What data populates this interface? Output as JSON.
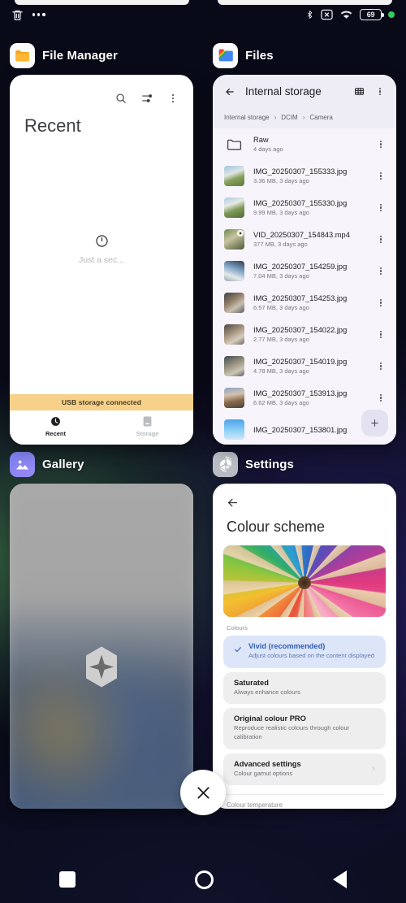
{
  "statusbar": {
    "trash_icon": "trash-icon",
    "more_icon": "more-options-icon",
    "bluetooth_icon": "bluetooth-icon",
    "sim_icon": "no-sim-icon",
    "wifi_icon": "wifi-6-icon",
    "wifi_label": "6",
    "battery_level": "69",
    "recording_dot": "green-status-dot"
  },
  "cards": {
    "file_manager": {
      "app_name": "File Manager",
      "app_icon": "folder-icon",
      "search_icon": "search-icon",
      "filter_icon": "tune-icon",
      "overflow_icon": "more-vert-icon",
      "title": "Recent",
      "loading_icon": "clock-icon",
      "loading_text": "Just a sec...",
      "banner": "USB storage connected",
      "tabs": [
        {
          "label": "Recent",
          "icon": "clock-icon",
          "selected": true
        },
        {
          "label": "Storage",
          "icon": "storage-icon",
          "selected": false
        }
      ]
    },
    "files": {
      "app_name": "Files",
      "app_icon": "google-files-icon",
      "back_icon": "arrow-back-icon",
      "appbar_title": "Internal storage",
      "grid_icon": "grid-view-icon",
      "overflow_icon": "more-vert-icon",
      "breadcrumbs": [
        "Internal storage",
        "DCIM",
        "Camera"
      ],
      "breadcrumb_separator": "›",
      "fab_icon": "add-icon",
      "fab_label": "+",
      "items": [
        {
          "name": "Raw",
          "sub": "4 days ago",
          "kind": "folder"
        },
        {
          "name": "IMG_20250307_155333.jpg",
          "sub": "3.36 MB, 3 days ago",
          "kind": "image"
        },
        {
          "name": "IMG_20250307_155330.jpg",
          "sub": "9.99 MB, 3 days ago",
          "kind": "image"
        },
        {
          "name": "VID_20250307_154843.mp4",
          "sub": "377 MB, 3 days ago",
          "kind": "video"
        },
        {
          "name": "IMG_20250307_154259.jpg",
          "sub": "7.04 MB, 3 days ago",
          "kind": "image"
        },
        {
          "name": "IMG_20250307_154253.jpg",
          "sub": "6.57 MB, 3 days ago",
          "kind": "image"
        },
        {
          "name": "IMG_20250307_154022.jpg",
          "sub": "2.77 MB, 3 days ago",
          "kind": "image"
        },
        {
          "name": "IMG_20250307_154019.jpg",
          "sub": "4.78 MB, 3 days ago",
          "kind": "image"
        },
        {
          "name": "IMG_20250307_153913.jpg",
          "sub": "6.62 MB, 3 days ago",
          "kind": "image"
        },
        {
          "name": "IMG_20250307_153801.jpg",
          "sub": "",
          "kind": "image"
        }
      ]
    },
    "gallery": {
      "app_name": "Gallery",
      "app_icon": "gallery-photo-icon",
      "placeholder_icon": "hexagon-sparkle-icon"
    },
    "settings": {
      "app_name": "Settings",
      "app_icon": "gear-icon",
      "back_icon": "arrow-back-icon",
      "title": "Colour scheme",
      "hero_icon": "coloured-pencils-image",
      "section_label": "Colours",
      "options": [
        {
          "name": "Vivid (recommended)",
          "desc": "Adjust colours based on the content displayed",
          "selected": true,
          "check_icon": "check-icon"
        },
        {
          "name": "Saturated",
          "desc": "Always enhance colours",
          "selected": false
        },
        {
          "name": "Original colour PRO",
          "desc": "Reproduce realistic colours through colour calibration",
          "selected": false
        },
        {
          "name": "Advanced settings",
          "desc": "Colour gamut options",
          "selected": false,
          "arrow": "›",
          "arrow_icon": "chevron-right-icon"
        }
      ],
      "footer_label": "Colour temperature"
    }
  },
  "close_all": {
    "icon": "close-icon",
    "label": "✕"
  },
  "navbar": {
    "recents_icon": "recents-square-icon",
    "home_icon": "home-circle-icon",
    "back_icon": "back-triangle-icon"
  },
  "colors": {
    "accent_blue": "#2d5bb8",
    "usb_banner": "#f7d08a",
    "battery_green": "#2fd15a"
  }
}
